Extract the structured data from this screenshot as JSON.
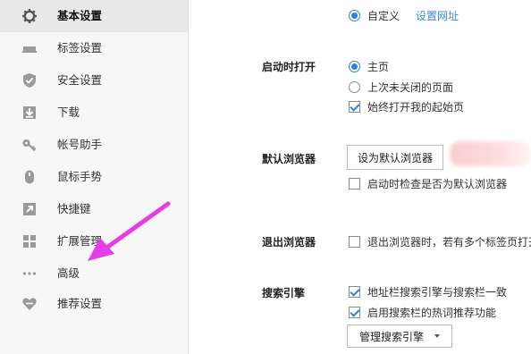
{
  "sidebar": {
    "items": [
      {
        "label": "基本设置",
        "icon": "gear-icon",
        "active": true
      },
      {
        "label": "标签设置",
        "icon": "tab-icon"
      },
      {
        "label": "安全设置",
        "icon": "shield-check-icon"
      },
      {
        "label": "下载",
        "icon": "download-icon"
      },
      {
        "label": "帐号助手",
        "icon": "key-icon"
      },
      {
        "label": "鼠标手势",
        "icon": "mouse-icon"
      },
      {
        "label": "快捷键",
        "icon": "shortcut-arrow-icon"
      },
      {
        "label": "扩展管理",
        "icon": "extensions-grid-icon"
      },
      {
        "label": "高级",
        "icon": "more-dots-icon"
      },
      {
        "label": "推荐设置",
        "icon": "heart-icon"
      }
    ]
  },
  "homepage": {
    "custom_option": "自定义",
    "set_url_link": "设置网址"
  },
  "startup": {
    "title": "启动时打开",
    "opt_home": "主页",
    "opt_last": "上次未关闭的页面",
    "opt_always_start": "始终打开我的起始页"
  },
  "default_browser": {
    "title": "默认浏览器",
    "set_button": "设为默认浏览器",
    "check_on_start": "启动时检查是否为默认浏览器"
  },
  "exit_browser": {
    "title": "退出浏览器",
    "warn_multi_tabs": "退出浏览器时，若有多个标签页打开"
  },
  "search_engine": {
    "title": "搜索引擎",
    "sync_addressbar": "地址栏搜索引擎与搜索栏一致",
    "enable_suggest": "启用搜索栏的热词推荐功能",
    "manage_button": "管理搜索引擎"
  },
  "colors": {
    "accent": "#2f7fe0",
    "link": "#3a87e0",
    "annotation_arrow": "#e83ce8",
    "sidebar_bg": "#f7f7f7",
    "sidebar_active_bg": "#e8e8e8"
  }
}
